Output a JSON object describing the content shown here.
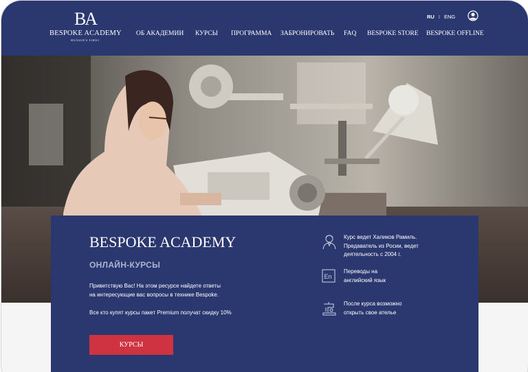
{
  "logo": {
    "mark": "BA",
    "name": "BESPOKE ACADEMY",
    "tagline": "RUSSIA'S FIRST"
  },
  "nav": {
    "items": [
      "ОБ АКАДЕМИИ",
      "КУРСЫ",
      "ПРОГРАММА",
      "ЗАБРОНИРОВАТЬ",
      "FAQ",
      "BESPOKE STORE",
      "BESPOKE OFFLINE"
    ]
  },
  "lang": {
    "ru": "RU",
    "separator": "I",
    "en": "ENG",
    "active": "RU"
  },
  "card": {
    "title": "BESPOKE ACADEMY",
    "subtitle": "ОНЛАЙН-КУРСЫ",
    "text_line1": "Приветствую Вас! На этом ресурсе найдете ответы",
    "text_line2": "на интересующие вас вопросы в технике Bespoke.",
    "promo": "Все кто купят курсы пакет Premium получат скидку 10%",
    "button": "КУРСЫ"
  },
  "features": [
    {
      "icon": "teacher-icon",
      "lines": [
        "Курс ведет Халиков Рамиль.",
        "Предаватель из Росии, ведет",
        "деятельность с 2004 г."
      ]
    },
    {
      "icon": "translation-en-icon",
      "label": "En",
      "lines": [
        "Переводы на",
        "английский язык"
      ]
    },
    {
      "icon": "sewing-machine-icon",
      "lines": [
        "После курса возможно",
        "открыть свое ателье"
      ]
    }
  ],
  "colors": {
    "header": "#2b3870",
    "button": "#cf3341",
    "subtitle": "#aeb5d3"
  }
}
